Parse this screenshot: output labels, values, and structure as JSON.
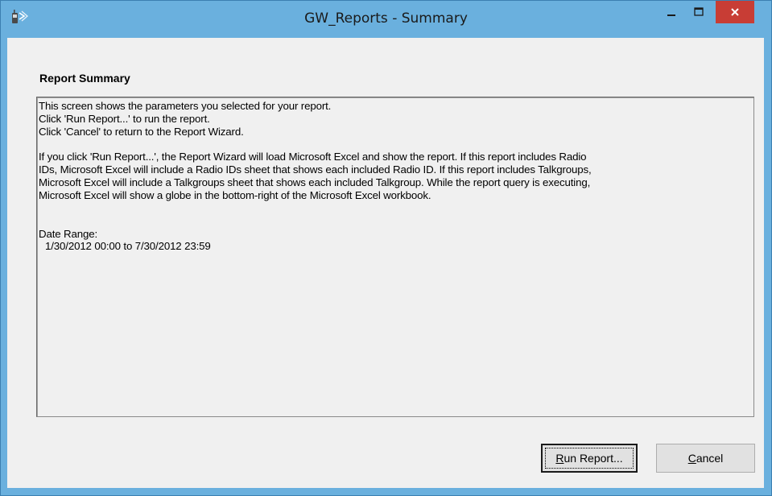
{
  "window": {
    "title": "GW_Reports - Summary",
    "icon": "radio-handset-icon"
  },
  "controls": {
    "minimize_icon": "minimize-icon",
    "maximize_icon": "maximize-icon",
    "close_icon": "close-icon"
  },
  "heading": "Report Summary",
  "summary": {
    "lines": [
      "This screen shows the parameters you selected for your report.",
      "Click 'Run Report...' to run the report.",
      "Click 'Cancel' to return to the Report Wizard."
    ],
    "paragraph": [
      "If you click 'Run Report...', the Report Wizard will load Microsoft Excel and show the report.  If this report includes Radio",
      "IDs, Microsoft Excel will include a Radio IDs sheet that shows each included Radio ID.  If this report includes Talkgroups,",
      "Microsoft Excel will include a Talkgroups sheet that shows each included Talkgroup.  While the report query is executing,",
      "Microsoft Excel will show a globe in the bottom-right of the Microsoft Excel workbook."
    ],
    "date_range_label": "Date Range:",
    "date_range_value": "1/30/2012 00:00 to 7/30/2012 23:59"
  },
  "buttons": {
    "run_mnemonic": "R",
    "run_rest": "un Report...",
    "cancel_mnemonic": "C",
    "cancel_rest": "ancel"
  },
  "colors": {
    "titlebar": "#6ab0de",
    "close_button": "#c83d35",
    "dialog_background": "#f0f0f0"
  }
}
